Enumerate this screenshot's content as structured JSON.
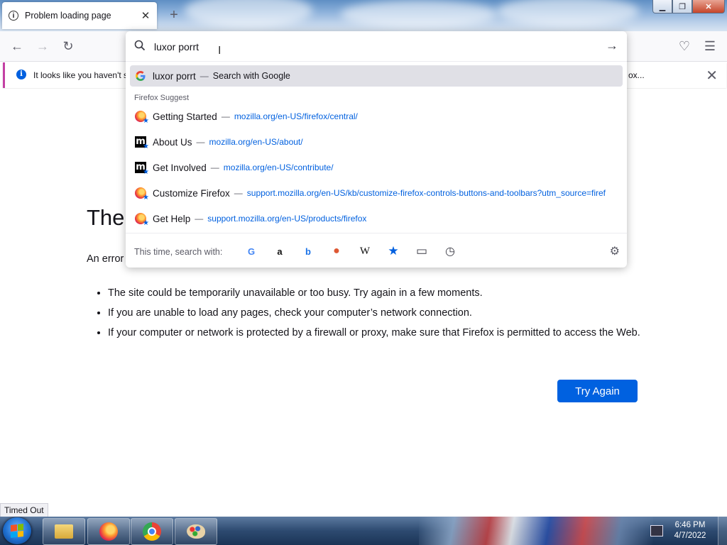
{
  "window": {
    "tab_title": "Problem loading page",
    "tab_icon": "i",
    "tab_close": "✕",
    "new_tab": "+",
    "minimize": "▁",
    "maximize": "❐",
    "close": "✕"
  },
  "navbar": {
    "back": "←",
    "forward": "→",
    "reload": "↻",
    "pocket": "♡",
    "menu": "☰"
  },
  "notification": {
    "text": "It looks like you haven't s",
    "button_partial": "ox...",
    "close": "✕"
  },
  "urlbar": {
    "value": "luxor porrt",
    "go": "→"
  },
  "suggestions": {
    "top": {
      "title": "luxor porrt",
      "action": "Search with Google"
    },
    "group_label": "Firefox Suggest",
    "items": [
      {
        "title": "Getting Started",
        "url": "mozilla.org/en-US/firefox/central/",
        "icon": "firefox-logo"
      },
      {
        "title": "About Us",
        "url": "mozilla.org/en-US/about/",
        "icon": "mozilla-logo"
      },
      {
        "title": "Get Involved",
        "url": "mozilla.org/en-US/contribute/",
        "icon": "mozilla-logo"
      },
      {
        "title": "Customize Firefox",
        "url": "support.mozilla.org/en-US/kb/customize-firefox-controls-buttons-and-toolbars?utm_source=firef",
        "icon": "firefox-logo"
      },
      {
        "title": "Get Help",
        "url": "support.mozilla.org/en-US/products/firefox",
        "icon": "firefox-logo"
      }
    ],
    "dash": "—"
  },
  "search_with": {
    "label": "This time, search with:",
    "engines": [
      {
        "name": "google",
        "glyph": "G",
        "color": "#4285f4"
      },
      {
        "name": "amazon",
        "glyph": "a",
        "color": "#111111"
      },
      {
        "name": "bing",
        "glyph": "b",
        "color": "#1a73e8"
      },
      {
        "name": "duckduckgo",
        "glyph": "●",
        "color": "#de5833"
      },
      {
        "name": "wikipedia",
        "glyph": "W",
        "color": "#111111"
      },
      {
        "name": "bookmarks",
        "glyph": "★",
        "color": "#0060df"
      },
      {
        "name": "tabs",
        "glyph": "▭",
        "color": "#3a3a44"
      },
      {
        "name": "history",
        "glyph": "◷",
        "color": "#3a3a44"
      }
    ],
    "settings": "⚙"
  },
  "error_page": {
    "title": "The",
    "intro": "An error",
    "bullets": [
      "The site could be temporarily unavailable or too busy. Try again in a few moments.",
      "If you are unable to load any pages, check your computer’s network connection.",
      "If your computer or network is protected by a firewall or proxy, make sure that Firefox is permitted to access the Web."
    ],
    "button": "Try Again"
  },
  "status_text": "Timed Out",
  "taskbar": {
    "time": "6:46 PM",
    "date": "4/7/2022",
    "apps": [
      "explorer",
      "firefox",
      "chrome",
      "paint"
    ]
  },
  "colors": {
    "accent": "#0061e0",
    "link": "#0060df",
    "notification_border": "#c340a4"
  }
}
